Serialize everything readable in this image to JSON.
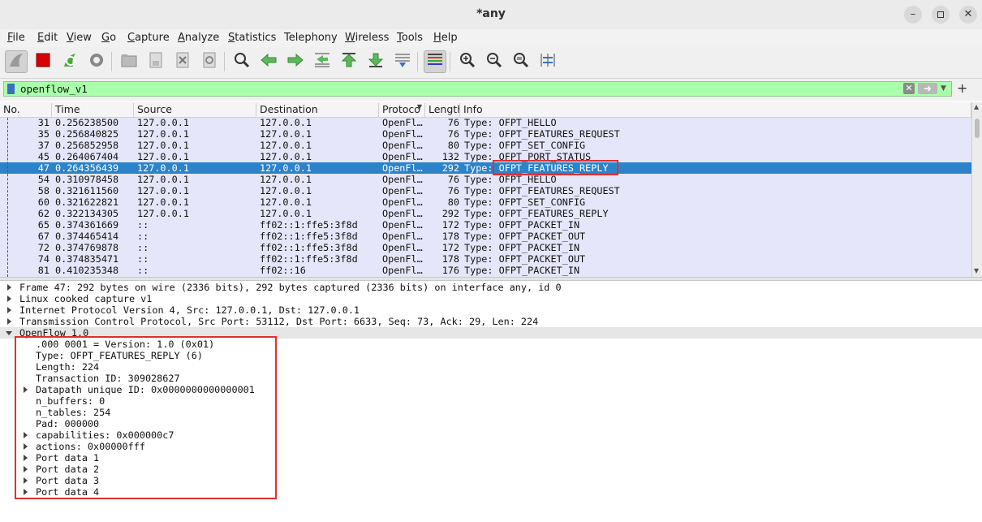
{
  "window": {
    "title": "*any"
  },
  "menu": [
    {
      "label": "File",
      "ul": "F",
      "rest": "ile"
    },
    {
      "label": "Edit",
      "ul": "E",
      "rest": "dit"
    },
    {
      "label": "View",
      "ul": "V",
      "rest": "iew"
    },
    {
      "label": "Go",
      "ul": "G",
      "rest": "o"
    },
    {
      "label": "Capture",
      "ul": "C",
      "rest": "apture"
    },
    {
      "label": "Analyze",
      "ul": "A",
      "rest": "nalyze"
    },
    {
      "label": "Statistics",
      "ul": "S",
      "rest": "tatistics"
    },
    {
      "label": "Telephony",
      "ul": "",
      "rest": "Telephony"
    },
    {
      "label": "Wireless",
      "ul": "W",
      "rest": "ireless"
    },
    {
      "label": "Tools",
      "ul": "T",
      "rest": "ools"
    },
    {
      "label": "Help",
      "ul": "H",
      "rest": "elp"
    }
  ],
  "filter": {
    "value": "openflow_v1"
  },
  "columns": [
    "No.",
    "Time",
    "Source",
    "Destination",
    "Protocol",
    "Length",
    "Info"
  ],
  "packets": [
    {
      "no": "31",
      "time": "0.256238500",
      "src": "127.0.0.1",
      "dst": "127.0.0.1",
      "proto": "OpenFl…",
      "len": "76",
      "info": "Type: OFPT_HELLO"
    },
    {
      "no": "35",
      "time": "0.256840825",
      "src": "127.0.0.1",
      "dst": "127.0.0.1",
      "proto": "OpenFl…",
      "len": "76",
      "info": "Type: OFPT_FEATURES_REQUEST"
    },
    {
      "no": "37",
      "time": "0.256852958",
      "src": "127.0.0.1",
      "dst": "127.0.0.1",
      "proto": "OpenFl…",
      "len": "80",
      "info": "Type: OFPT_SET_CONFIG"
    },
    {
      "no": "45",
      "time": "0.264067404",
      "src": "127.0.0.1",
      "dst": "127.0.0.1",
      "proto": "OpenFl…",
      "len": "132",
      "info": "Type: OFPT_PORT_STATUS"
    },
    {
      "no": "47",
      "time": "0.264356439",
      "src": "127.0.0.1",
      "dst": "127.0.0.1",
      "proto": "OpenFl…",
      "len": "292",
      "info": "Type: OFPT_FEATURES_REPLY",
      "selected": true
    },
    {
      "no": "54",
      "time": "0.310978458",
      "src": "127.0.0.1",
      "dst": "127.0.0.1",
      "proto": "OpenFl…",
      "len": "76",
      "info": "Type: OFPT_HELLO"
    },
    {
      "no": "58",
      "time": "0.321611560",
      "src": "127.0.0.1",
      "dst": "127.0.0.1",
      "proto": "OpenFl…",
      "len": "76",
      "info": "Type: OFPT_FEATURES_REQUEST"
    },
    {
      "no": "60",
      "time": "0.321622821",
      "src": "127.0.0.1",
      "dst": "127.0.0.1",
      "proto": "OpenFl…",
      "len": "80",
      "info": "Type: OFPT_SET_CONFIG"
    },
    {
      "no": "62",
      "time": "0.322134305",
      "src": "127.0.0.1",
      "dst": "127.0.0.1",
      "proto": "OpenFl…",
      "len": "292",
      "info": "Type: OFPT_FEATURES_REPLY"
    },
    {
      "no": "65",
      "time": "0.374361669",
      "src": "::",
      "dst": "ff02::1:ffe5:3f8d",
      "proto": "OpenFl…",
      "len": "172",
      "info": "Type: OFPT_PACKET_IN"
    },
    {
      "no": "67",
      "time": "0.374465414",
      "src": "::",
      "dst": "ff02::1:ffe5:3f8d",
      "proto": "OpenFl…",
      "len": "178",
      "info": "Type: OFPT_PACKET_OUT"
    },
    {
      "no": "72",
      "time": "0.374769878",
      "src": "::",
      "dst": "ff02::1:ffe5:3f8d",
      "proto": "OpenFl…",
      "len": "172",
      "info": "Type: OFPT_PACKET_IN"
    },
    {
      "no": "74",
      "time": "0.374835471",
      "src": "::",
      "dst": "ff02::1:ffe5:3f8d",
      "proto": "OpenFl…",
      "len": "178",
      "info": "Type: OFPT_PACKET_OUT"
    },
    {
      "no": "81",
      "time": "0.410235348",
      "src": "::",
      "dst": "ff02::16",
      "proto": "OpenFl…",
      "len": "176",
      "info": "Type: OFPT_PACKET_IN"
    }
  ],
  "details": [
    {
      "text": "Frame 47: 292 bytes on wire (2336 bits), 292 bytes captured (2336 bits) on interface any, id 0",
      "level": 0,
      "expander": "collapsed"
    },
    {
      "text": "Linux cooked capture v1",
      "level": 0,
      "expander": "collapsed"
    },
    {
      "text": "Internet Protocol Version 4, Src: 127.0.0.1, Dst: 127.0.0.1",
      "level": 0,
      "expander": "collapsed"
    },
    {
      "text": "Transmission Control Protocol, Src Port: 53112, Dst Port: 6633, Seq: 73, Ack: 29, Len: 224",
      "level": 0,
      "expander": "collapsed"
    },
    {
      "text": "OpenFlow 1.0",
      "level": 0,
      "expander": "expanded",
      "highlight": true
    },
    {
      "text": ".000 0001 = Version: 1.0 (0x01)",
      "level": 1,
      "expander": "none"
    },
    {
      "text": "Type: OFPT_FEATURES_REPLY (6)",
      "level": 1,
      "expander": "none"
    },
    {
      "text": "Length: 224",
      "level": 1,
      "expander": "none"
    },
    {
      "text": "Transaction ID: 309028627",
      "level": 1,
      "expander": "none"
    },
    {
      "text": "Datapath unique ID: 0x0000000000000001",
      "level": 1,
      "expander": "collapsed"
    },
    {
      "text": "n_buffers: 0",
      "level": 1,
      "expander": "none"
    },
    {
      "text": "n_tables: 254",
      "level": 1,
      "expander": "none"
    },
    {
      "text": "Pad: 000000",
      "level": 1,
      "expander": "none"
    },
    {
      "text": "capabilities: 0x000000c7",
      "level": 1,
      "expander": "collapsed"
    },
    {
      "text": "actions: 0x00000fff",
      "level": 1,
      "expander": "collapsed"
    },
    {
      "text": "Port data 1",
      "level": 1,
      "expander": "collapsed"
    },
    {
      "text": "Port data 2",
      "level": 1,
      "expander": "collapsed"
    },
    {
      "text": "Port data 3",
      "level": 1,
      "expander": "collapsed"
    },
    {
      "text": "Port data 4",
      "level": 1,
      "expander": "collapsed"
    }
  ],
  "toolbar_icons": [
    "shark-fin-start-icon",
    "stop-capture-icon",
    "restart-capture-icon",
    "capture-options-icon",
    "open-file-icon",
    "save-file-icon",
    "close-file-icon",
    "reload-file-icon",
    "find-packet-icon",
    "go-back-icon",
    "go-forward-icon",
    "go-to-packet-icon",
    "go-first-packet-icon",
    "go-last-packet-icon",
    "autoscroll-icon",
    "colorize-icon",
    "zoom-in-icon",
    "zoom-out-icon",
    "normal-size-icon",
    "resize-columns-icon"
  ],
  "colors": {
    "selected_row": "#2c83c9",
    "row_bg": "#e6e6fa",
    "filter_ok": "#aaffaa",
    "annotation": "#e03030"
  }
}
